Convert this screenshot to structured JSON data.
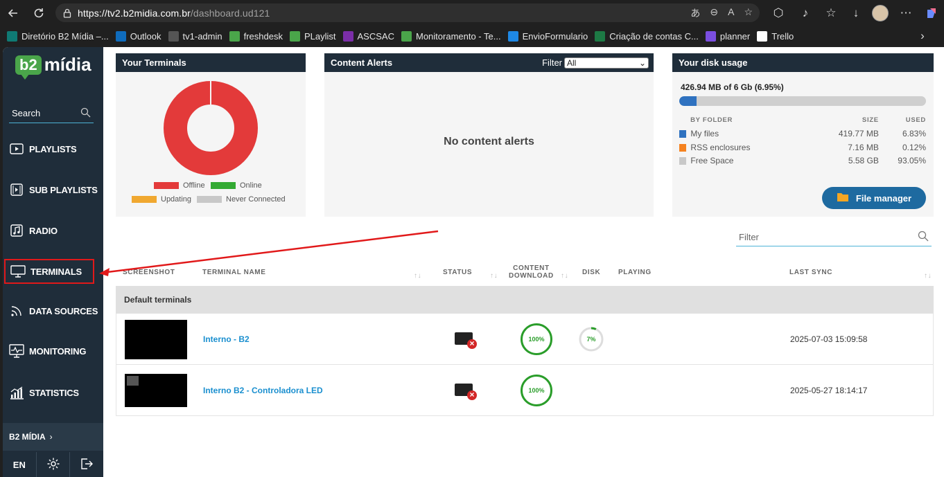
{
  "browser": {
    "url_host": "https://tv2.b2midia.com.br",
    "url_path": "/dashboard.ud121",
    "bookmarks": [
      {
        "label": "Diretório B2 Mídia –...",
        "icon": "sharepoint-icon",
        "color": "#0f7a74"
      },
      {
        "label": "Outlook",
        "icon": "outlook-icon",
        "color": "#0f6cbd"
      },
      {
        "label": "tv1-admin",
        "icon": "globe-icon",
        "color": "#555555"
      },
      {
        "label": "freshdesk",
        "icon": "b2-icon",
        "color": "#4aa54a"
      },
      {
        "label": "PLaylist",
        "icon": "b2-icon",
        "color": "#4aa54a"
      },
      {
        "label": "ASCSAC",
        "icon": "forms-icon",
        "color": "#7b2ea8"
      },
      {
        "label": "Monitoramento - Te...",
        "icon": "b2-icon",
        "color": "#4aa54a"
      },
      {
        "label": "EnvioFormulario",
        "icon": "onedrive-icon",
        "color": "#1e88e5"
      },
      {
        "label": "Criação de contas C...",
        "icon": "excel-icon",
        "color": "#1d7a45"
      },
      {
        "label": "planner",
        "icon": "planner-icon",
        "color": "#7a4ee0"
      },
      {
        "label": "Trello",
        "icon": "trello-icon",
        "color": "#ffffff"
      }
    ]
  },
  "sidebar": {
    "logo_b2": "b2",
    "logo_text": "mídia",
    "search_label": "Search",
    "items": [
      {
        "label": "PLAYLISTS",
        "icon": "playlist-icon"
      },
      {
        "label": "SUB PLAYLISTS",
        "icon": "sub-playlist-icon"
      },
      {
        "label": "RADIO",
        "icon": "radio-icon"
      },
      {
        "label": "TERMINALS",
        "icon": "monitor-icon"
      },
      {
        "label": "DATA SOURCES",
        "icon": "rss-icon"
      },
      {
        "label": "MONITORING",
        "icon": "monitoring-icon"
      },
      {
        "label": "STATISTICS",
        "icon": "statistics-icon"
      }
    ],
    "brand": "B2 MÍDIA",
    "lang": "EN"
  },
  "terminals_card": {
    "title": "Your Terminals",
    "legend": [
      {
        "label": "Offline",
        "color": "#e33a3a"
      },
      {
        "label": "Online",
        "color": "#33aa33"
      },
      {
        "label": "Updating",
        "color": "#f0a830"
      },
      {
        "label": "Never Connected",
        "color": "#c8c8c8"
      }
    ],
    "offline_fraction": 1.0
  },
  "alerts_card": {
    "title": "Content Alerts",
    "filter_label": "Filter",
    "filter_value": "All",
    "empty_text": "No content alerts"
  },
  "disk_card": {
    "title": "Your disk usage",
    "summary": "426.94 MB of 6 Gb (6.95%)",
    "used_fraction": 0.0695,
    "col_folder": "BY FOLDER",
    "col_size": "SIZE",
    "col_used": "USED",
    "rows": [
      {
        "name": "My files",
        "size": "419.77 MB",
        "used": "6.83%",
        "color": "#2f72c0"
      },
      {
        "name": "RSS enclosures",
        "size": "7.16 MB",
        "used": "0.12%",
        "color": "#f58220"
      },
      {
        "name": "Free Space",
        "size": "5.58 GB",
        "used": "93.05%",
        "color": "#c8c8c8"
      }
    ],
    "button": "File manager"
  },
  "table": {
    "filter_placeholder": "Filter",
    "headers": {
      "screenshot": "SCREENSHOT",
      "name": "TERMINAL NAME",
      "status": "STATUS",
      "content_download_1": "CONTENT",
      "content_download_2": "DOWNLOAD",
      "disk": "DISK",
      "playing": "PLAYING",
      "last_sync": "LAST SYNC"
    },
    "group": "Default terminals",
    "rows": [
      {
        "name": "Interno - B2",
        "status": "offline",
        "download": "100%",
        "download_fraction": 1.0,
        "disk": "7%",
        "disk_fraction": 0.07,
        "last_sync": "2025-07-03 15:09:58"
      },
      {
        "name": "Interno B2 - Controladora LED",
        "status": "offline",
        "download": "100%",
        "download_fraction": 1.0,
        "disk": "",
        "last_sync": "2025-05-27 18:14:17"
      }
    ]
  }
}
